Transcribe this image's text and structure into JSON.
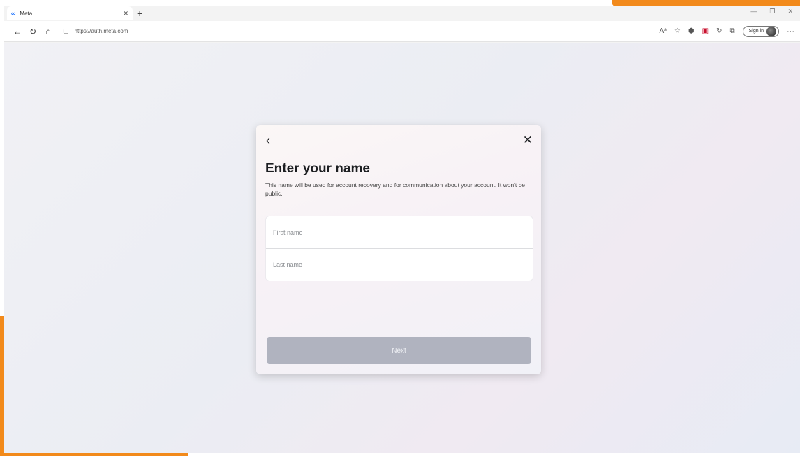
{
  "browser": {
    "tab_title": "Meta",
    "tab_favicon": "∞",
    "new_tab": "+",
    "url": "https://auth.meta.com",
    "sign_in": "Sign in",
    "more_label": "···"
  },
  "icons": {
    "back": "back-arrow-icon",
    "refresh": "refresh-icon",
    "home": "home-icon",
    "close": "close-icon"
  },
  "colors": {
    "next_disabled": "#b0b3bf",
    "accent_orange": "#f28a1b"
  },
  "dialog": {
    "back_glyph": "‹",
    "close_glyph": "✕",
    "title": "Enter your name",
    "description": "This name will be used for account recovery and for communication about your account. It won't be public.",
    "first_name_placeholder": "First name",
    "last_name_placeholder": "Last name",
    "next_label": "Next"
  }
}
